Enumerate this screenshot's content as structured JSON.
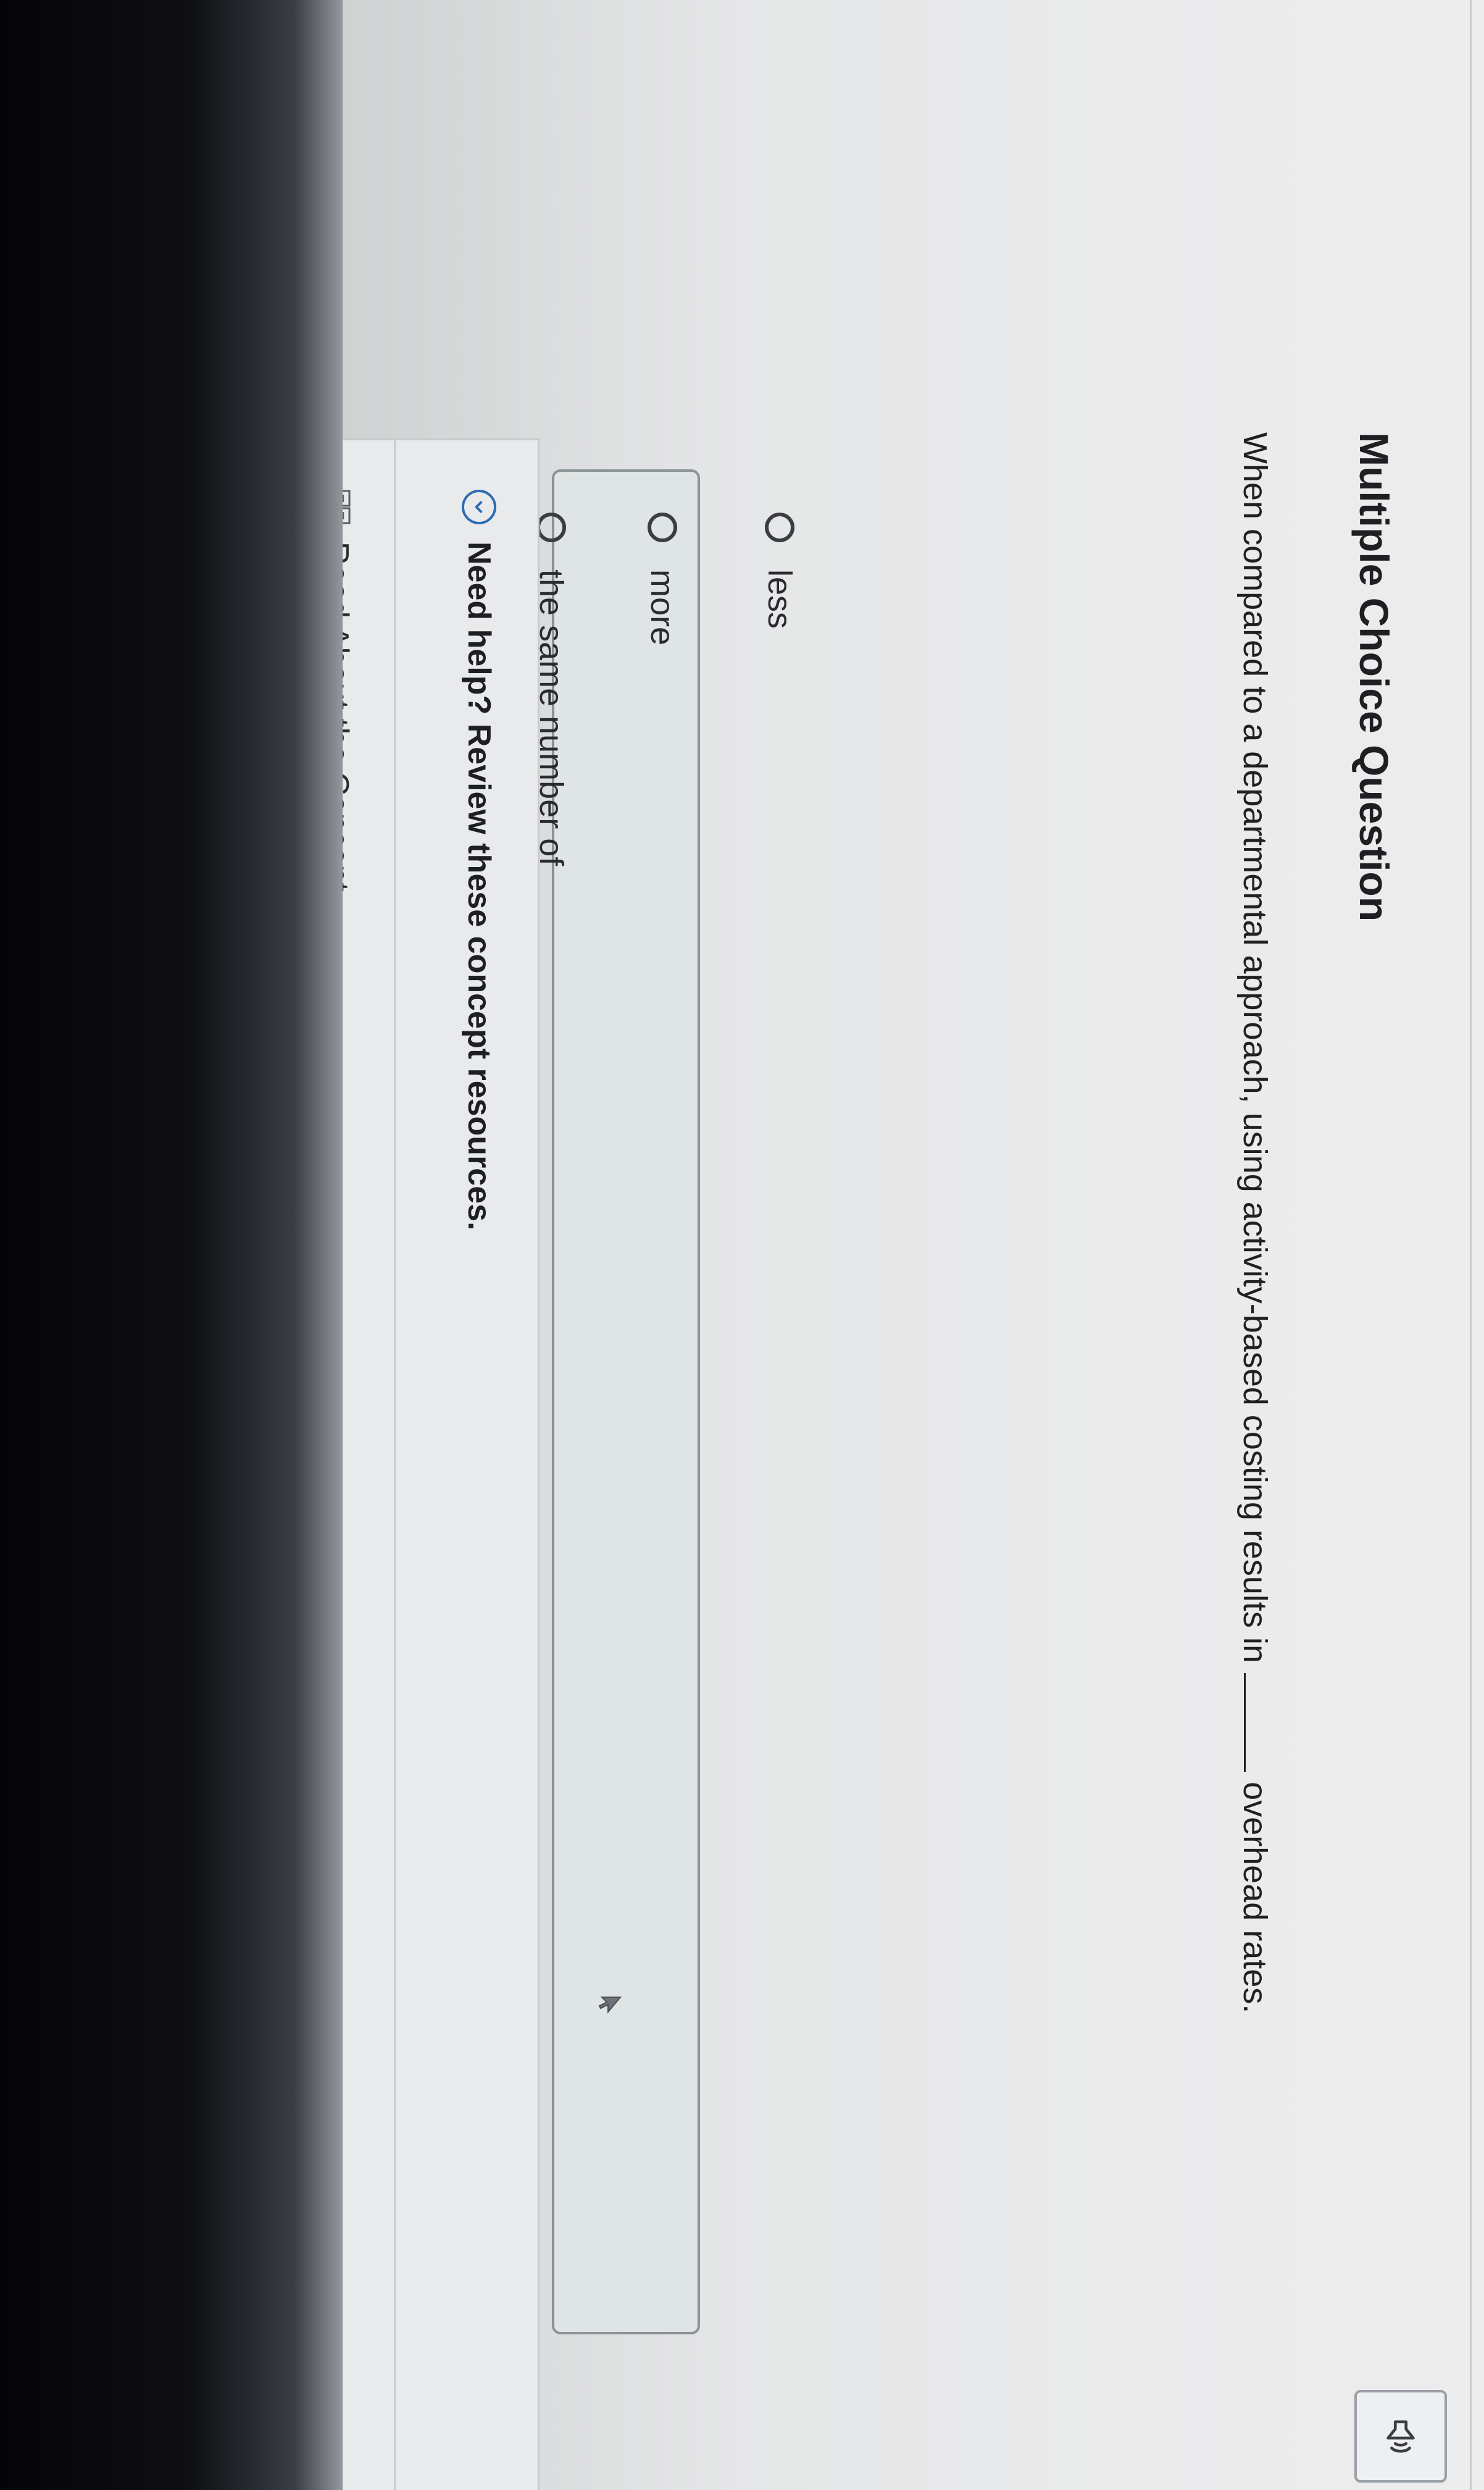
{
  "question": {
    "title": "Multiple Choice Question",
    "stem_before": "When compared to a departmental approach, using activity-based costing results in",
    "stem_after": "overhead rates."
  },
  "options": [
    {
      "label": "less",
      "selected": false
    },
    {
      "label": "more",
      "selected": false,
      "highlighted": true
    },
    {
      "label": "the same number of",
      "selected": false
    }
  ],
  "help": {
    "header": "Need help? Review these concept resources.",
    "link": "Read About the Concept"
  },
  "icons": {
    "audio": "speaker-icon",
    "help_toggle": "chevron-circle-icon",
    "resource": "book-icon"
  },
  "colors": {
    "accent": "#2d6bb3",
    "highlight_bg": "#dfe4e4"
  }
}
